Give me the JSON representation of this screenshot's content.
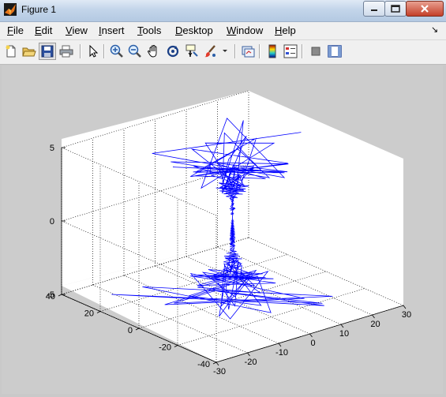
{
  "window": {
    "title": "Figure 1",
    "menus": [
      {
        "label": "File",
        "u": "F",
        "rest": "ile"
      },
      {
        "label": "Edit",
        "u": "E",
        "rest": "dit"
      },
      {
        "label": "View",
        "u": "V",
        "rest": "iew"
      },
      {
        "label": "Insert",
        "u": "I",
        "rest": "nsert"
      },
      {
        "label": "Tools",
        "u": "T",
        "rest": "ools"
      },
      {
        "label": "Desktop",
        "u": "D",
        "rest": "esktop"
      },
      {
        "label": "Window",
        "u": "W",
        "rest": "indow"
      },
      {
        "label": "Help",
        "u": "H",
        "rest": "elp"
      }
    ],
    "dock_arrow": "↘"
  },
  "toolbar": {
    "icons": [
      "new-figure-icon",
      "open-file-icon",
      "save-figure-icon",
      "print-figure-icon",
      "edit-plot-icon",
      "zoom-in-icon",
      "zoom-out-icon",
      "pan-icon",
      "rotate-3d-icon",
      "data-cursor-icon",
      "brush-icon",
      "link-plot-icon",
      "insert-colorbar-icon",
      "insert-legend-icon",
      "hide-plot-tools-icon",
      "show-plot-tools-icon"
    ]
  },
  "chart_data": {
    "type": "line3d",
    "title": "",
    "xlabel": "",
    "ylabel": "",
    "zlabel": "",
    "xlim": [
      -30,
      30
    ],
    "ylim": [
      -40,
      40
    ],
    "zlim": [
      -5,
      5
    ],
    "x_ticks": [
      "-30",
      "-20",
      "-10",
      "0",
      "10",
      "20",
      "30"
    ],
    "y_ticks": [
      "-40",
      "-20",
      "0",
      "20",
      "40"
    ],
    "z_ticks": [
      "-5",
      "0",
      "5"
    ],
    "grid": true,
    "series_color": "#0000ff",
    "series": [
      {
        "description": "spiral line, wide at z=±5, narrow near z=0"
      }
    ]
  }
}
